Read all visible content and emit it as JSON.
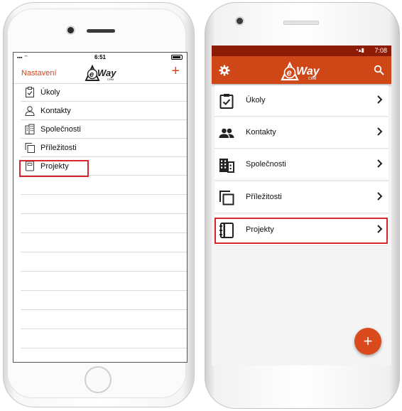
{
  "brand": {
    "logo_text": "Way",
    "logo_letter": "e",
    "logo_sub": "CRM"
  },
  "colors": {
    "accent": "#d4451d",
    "android_appbar": "#cf4617",
    "android_statusbar": "#8d1c07",
    "highlight": "#d7262e"
  },
  "ios": {
    "status": {
      "time": "6:51"
    },
    "nav": {
      "settings_label": "Nastavení",
      "add_label": "+"
    },
    "menu": [
      {
        "label": "Úkoly",
        "icon": "clipboard-check-icon"
      },
      {
        "label": "Kontakty",
        "icon": "person-icon"
      },
      {
        "label": "Společnosti",
        "icon": "building-icon"
      },
      {
        "label": "Příležitosti",
        "icon": "copy-stack-icon"
      },
      {
        "label": "Projekty",
        "icon": "notebook-icon"
      }
    ]
  },
  "android": {
    "status": {
      "time": "7:08"
    },
    "menu": [
      {
        "label": "Úkoly",
        "icon": "clipboard-check-icon"
      },
      {
        "label": "Kontakty",
        "icon": "people-icon"
      },
      {
        "label": "Společnosti",
        "icon": "building-icon"
      },
      {
        "label": "Příležitosti",
        "icon": "copy-stack-icon"
      },
      {
        "label": "Projekty",
        "icon": "notebook-icon"
      }
    ],
    "fab_label": "+"
  }
}
